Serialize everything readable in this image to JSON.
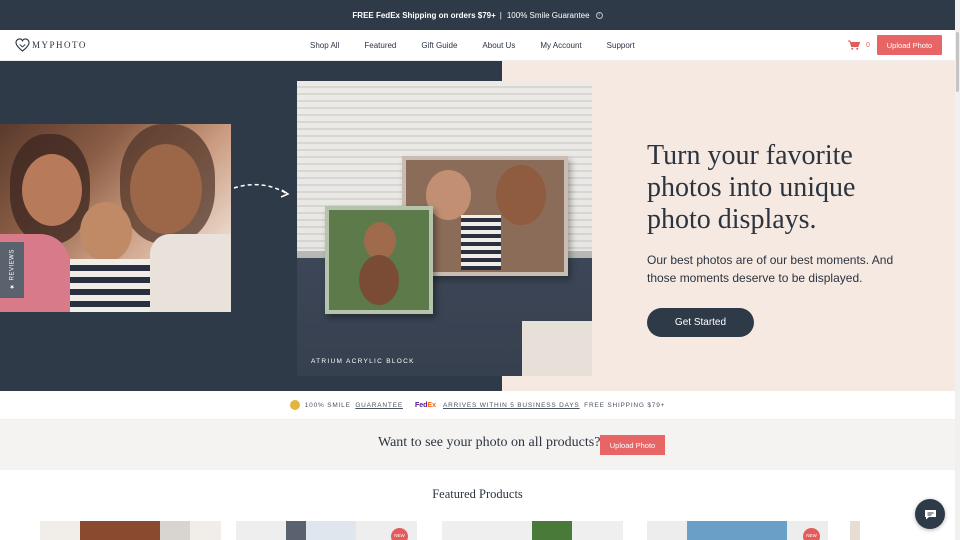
{
  "promo": {
    "shipping": "FREE FedEx Shipping on orders $79+",
    "separator": "|",
    "guarantee": "100% Smile Guarantee",
    "info_icon": "info-icon"
  },
  "header": {
    "logo_text": "MYPHOTO",
    "nav": [
      "Shop All",
      "Featured",
      "Gift Guide",
      "About Us",
      "My Account",
      "Support"
    ],
    "cart_count": "0",
    "upload_label": "Upload Photo"
  },
  "hero": {
    "reviews_tab": "★ REVIEWS",
    "caption": "ATRIUM ACRYLIC BLOCK",
    "title": "Turn your favorite photos into unique photo displays.",
    "subtitle": "Our best photos are of our best moments. And those moments deserve to be displayed.",
    "cta": "Get Started"
  },
  "trust": {
    "smile_prefix": "100% SMILE",
    "smile_link": "GUARANTEE",
    "fedex_fe": "Fed",
    "fedex_ex": "Ex",
    "arrives_link": "ARRIVES WITHIN 5 BUSINESS DAYS",
    "free_shipping": "FREE SHIPPING $79+"
  },
  "band": {
    "text": "Want to see your photo on all products?",
    "button": "Upload Photo"
  },
  "featured": {
    "title": "Featured Products",
    "badge": "NEW"
  },
  "colors": {
    "navy": "#2f3a48",
    "accent": "#e86565",
    "cream": "#f5e9e1"
  }
}
